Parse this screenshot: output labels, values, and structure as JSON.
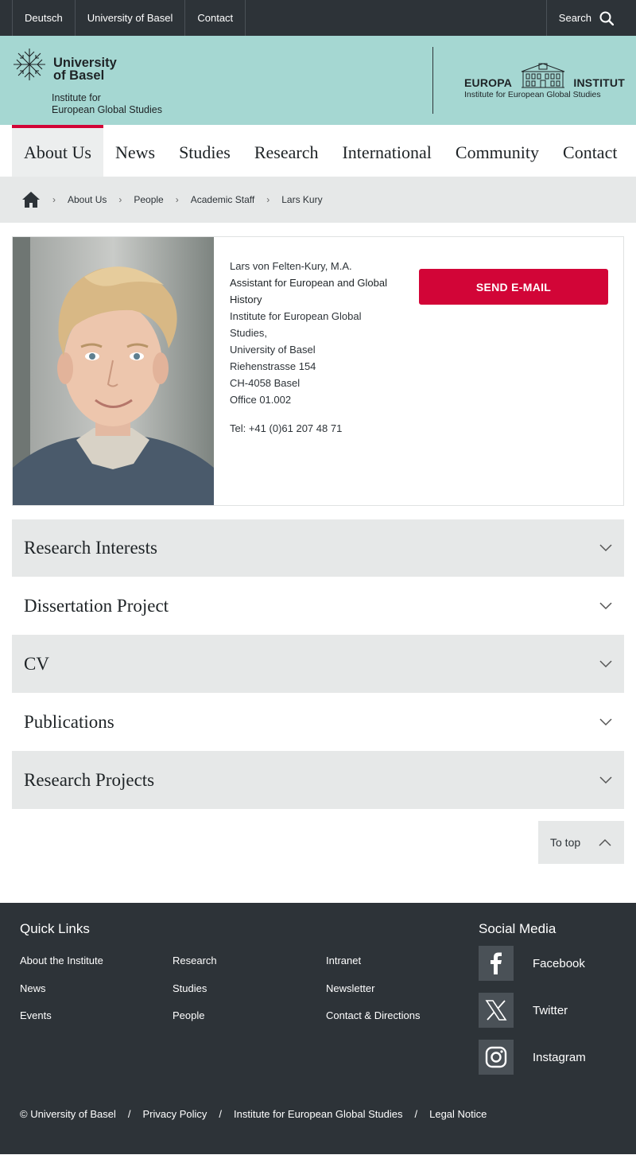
{
  "topbar": {
    "links": [
      "Deutsch",
      "University of Basel",
      "Contact"
    ],
    "search_label": "Search"
  },
  "header": {
    "university_line1": "University",
    "university_line2": "of Basel",
    "institute_line1": "Institute for",
    "institute_line2": "European Global Studies",
    "partner_word_left": "EUROPA",
    "partner_word_right": "INSTITUT",
    "partner_subtitle": "Institute for European Global Studies"
  },
  "nav": {
    "items": [
      "About Us",
      "News",
      "Studies",
      "Research",
      "International",
      "Community",
      "Contact"
    ],
    "active": "About Us"
  },
  "breadcrumb": {
    "items": [
      "About Us",
      "People",
      "Academic Staff",
      "Lars Kury"
    ]
  },
  "profile": {
    "name": "Lars von Felten-Kury, M.A.",
    "role_line1": "Assistant for European and Global",
    "role_line2": "History",
    "address_lines": [
      "Institute for European Global",
      "Studies,",
      "University of Basel",
      "Riehenstrasse 154",
      "CH-4058 Basel",
      "Office 01.002"
    ],
    "phone": "Tel: +41 (0)61 207 48 71",
    "email_button": "SEND E-MAIL"
  },
  "accordion": {
    "items": [
      "Research Interests",
      "Dissertation Project",
      "CV",
      "Publications",
      "Research Projects"
    ]
  },
  "to_top": "To top",
  "footer": {
    "quick_links_title": "Quick Links",
    "quick_links": [
      "About the Institute",
      "Research",
      "Intranet",
      "News",
      "Studies",
      "Newsletter",
      "Events",
      "People",
      "Contact & Directions"
    ],
    "social_title": "Social Media",
    "social": [
      {
        "label": "Facebook",
        "icon": "facebook-icon"
      },
      {
        "label": "Twitter",
        "icon": "x-twitter-icon"
      },
      {
        "label": "Instagram",
        "icon": "instagram-icon"
      }
    ],
    "legal": [
      "© University of Basel",
      "Privacy Policy",
      "Institute for European Global Studies",
      "Legal Notice"
    ],
    "separator": "/"
  },
  "colors": {
    "accent_red": "#d20537",
    "header_mint": "#a5d7d2",
    "dark": "#2d3338",
    "light_gray": "#e6e8e8"
  }
}
